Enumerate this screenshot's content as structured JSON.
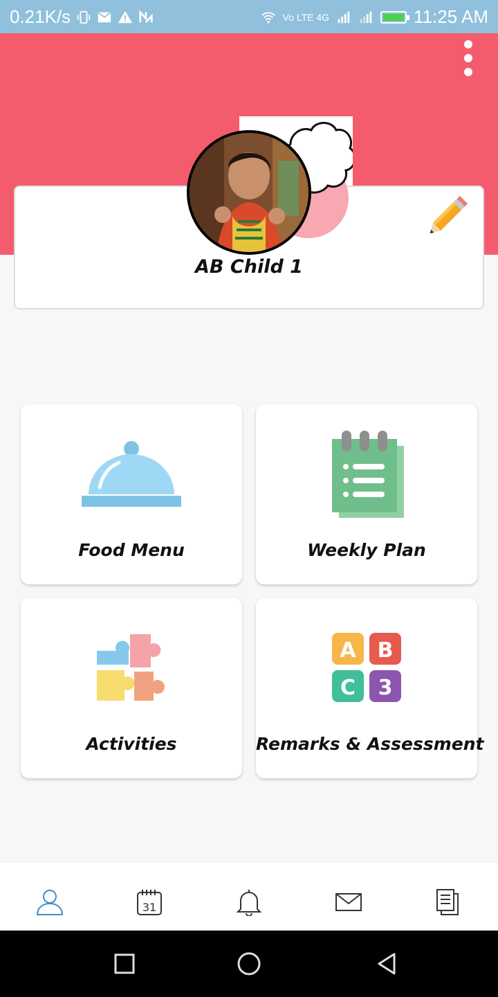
{
  "status_bar": {
    "speed": "0.21K/s",
    "time": "11:25 AM",
    "network": "Vo LTE 4G",
    "battery_level": 1.0,
    "icons": [
      "vibrate-icon",
      "mail-icon",
      "warning-icon",
      "nfc-icon",
      "wifi-icon",
      "signal-icon",
      "battery-icon"
    ]
  },
  "header": {
    "background_color": "#f45c6e",
    "menu_icon": "more-vertical-icon"
  },
  "profile": {
    "name": "AB Child 1",
    "edit_icon": "pencil-icon"
  },
  "tiles": [
    {
      "label": "Food Menu",
      "icon": "food-cloche-icon"
    },
    {
      "label": "Weekly Plan",
      "icon": "notepad-icon"
    },
    {
      "label": "Activities",
      "icon": "puzzle-icon"
    },
    {
      "label": "Remarks & Assessment",
      "icon": "abc-blocks-icon"
    }
  ],
  "bottom_nav": {
    "items": [
      {
        "icon": "profile-icon",
        "active": true
      },
      {
        "icon": "calendar-icon",
        "date": "31"
      },
      {
        "icon": "bell-icon"
      },
      {
        "icon": "mail-icon"
      },
      {
        "icon": "documents-icon"
      }
    ],
    "active_color": "#3b8fc7"
  },
  "system_nav": {
    "items": [
      "recents-icon",
      "home-icon",
      "back-icon"
    ]
  }
}
